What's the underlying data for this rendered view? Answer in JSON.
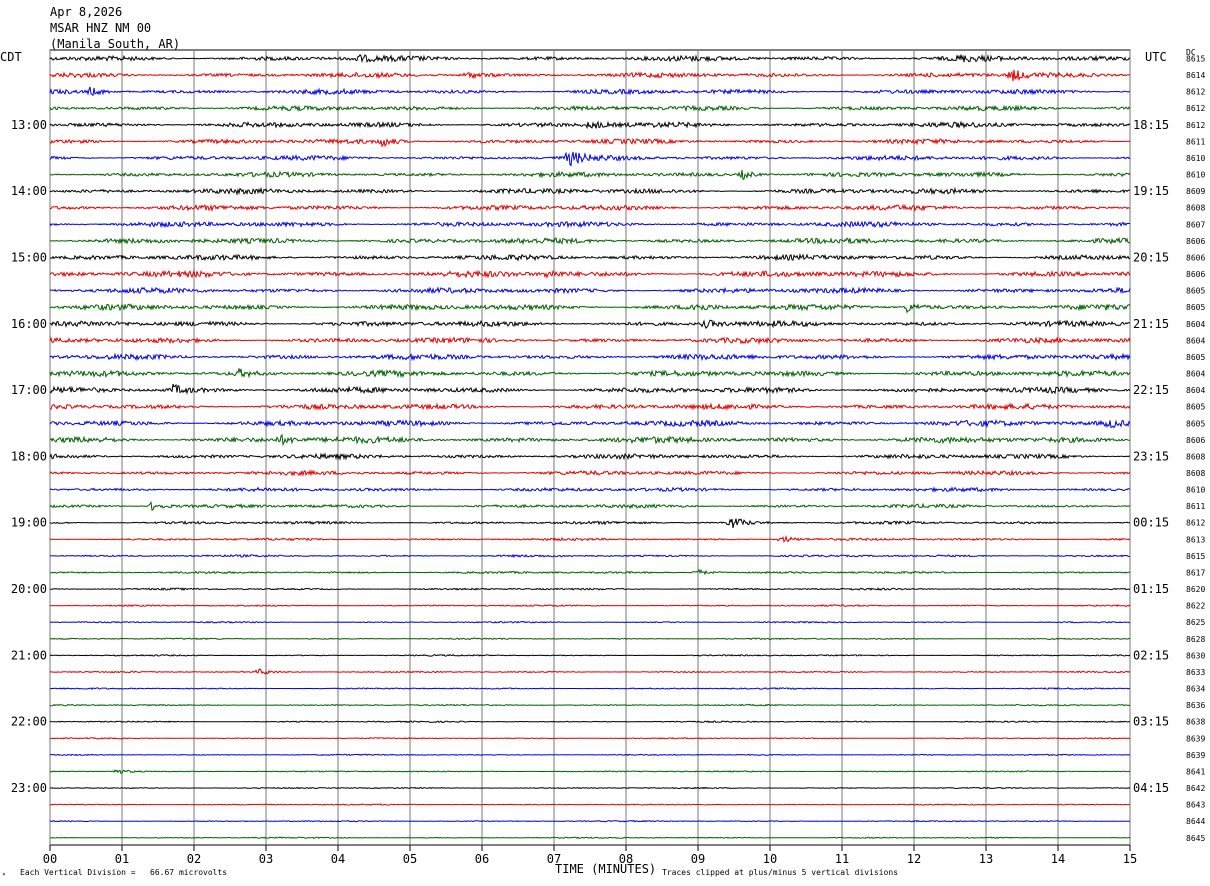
{
  "header": {
    "date": "Apr 8,2026",
    "station": "MSAR HNZ NM 00",
    "location": "(Manila South, AR)"
  },
  "labels": {
    "left_tz": "CDT",
    "right_tz": "UTC",
    "dc": "DC",
    "corner_mark": "ᴿ"
  },
  "footer": {
    "division_note": "Each Vertical Division =   66.67 microvolts",
    "clip_note": "Traces clipped at plus/minus 5 vertical divisions"
  },
  "chart_data": {
    "type": "line",
    "title": "",
    "xlabel": "TIME (MINUTES)",
    "ylabel": "",
    "xlim": [
      0,
      15
    ],
    "x_ticks": [
      "00",
      "01",
      "02",
      "03",
      "04",
      "05",
      "06",
      "07",
      "08",
      "09",
      "10",
      "11",
      "12",
      "13",
      "14",
      "15"
    ],
    "left_time_labels": [
      "13:00",
      "14:00",
      "15:00",
      "16:00",
      "17:00",
      "18:00",
      "19:00",
      "20:00",
      "21:00",
      "22:00",
      "23:00"
    ],
    "right_time_labels": [
      "18:15",
      "19:15",
      "20:15",
      "21:15",
      "22:15",
      "23:15",
      "00:15",
      "01:15",
      "02:15",
      "03:15",
      "04:15"
    ],
    "first_label_trace_index": 4,
    "traces_per_hour": 4,
    "trace_colors": [
      "#000000",
      "#e00000",
      "#0000e0",
      "#006000"
    ],
    "dc_offsets": [
      8615,
      8614,
      8612,
      8612,
      8612,
      8611,
      8610,
      8610,
      8609,
      8608,
      8607,
      8606,
      8606,
      8606,
      8605,
      8605,
      8604,
      8604,
      8605,
      8604,
      8604,
      8605,
      8605,
      8606,
      8608,
      8608,
      8610,
      8611,
      8612,
      8613,
      8615,
      8617,
      8620,
      8622,
      8625,
      8628,
      8630,
      8633,
      8634,
      8636,
      8638,
      8639,
      8639,
      8641,
      8642,
      8643,
      8644,
      8645
    ],
    "noise_level": [
      2.2,
      2.0,
      2.0,
      2.0,
      2.2,
      2.0,
      2.0,
      2.0,
      2.2,
      2.2,
      2.2,
      2.3,
      2.2,
      2.6,
      2.3,
      2.4,
      2.3,
      2.2,
      2.3,
      2.4,
      2.4,
      2.3,
      2.4,
      2.6,
      2.0,
      1.8,
      1.6,
      1.5,
      1.2,
      1.0,
      0.9,
      0.9,
      0.8,
      0.7,
      0.6,
      0.6,
      0.6,
      0.6,
      0.6,
      0.6,
      0.6,
      0.5,
      0.5,
      0.5,
      0.5,
      0.5,
      0.5,
      0.5
    ],
    "events": [
      {
        "trace": 0,
        "minute": 4.25,
        "amp": 3
      },
      {
        "trace": 0,
        "minute": 12.6,
        "amp": 3
      },
      {
        "trace": 1,
        "minute": 5.8,
        "amp": 3
      },
      {
        "trace": 1,
        "minute": 13.35,
        "amp": 6
      },
      {
        "trace": 2,
        "minute": 0.55,
        "amp": 4
      },
      {
        "trace": 4,
        "minute": 7.5,
        "amp": 4
      },
      {
        "trace": 5,
        "minute": 4.6,
        "amp": 5
      },
      {
        "trace": 6,
        "minute": 7.2,
        "amp": 7
      },
      {
        "trace": 7,
        "minute": 9.6,
        "amp": 5
      },
      {
        "trace": 13,
        "minute": 6.9,
        "amp": 4
      },
      {
        "trace": 15,
        "minute": 8.9,
        "amp": 4
      },
      {
        "trace": 15,
        "minute": 11.9,
        "amp": 5
      },
      {
        "trace": 16,
        "minute": 9.1,
        "amp": 4
      },
      {
        "trace": 19,
        "minute": 2.6,
        "amp": 4
      },
      {
        "trace": 20,
        "minute": 1.7,
        "amp": 5
      },
      {
        "trace": 22,
        "minute": 14.7,
        "amp": 4
      },
      {
        "trace": 23,
        "minute": 3.2,
        "amp": 4
      },
      {
        "trace": 27,
        "minute": 1.4,
        "amp": 5
      },
      {
        "trace": 28,
        "minute": 9.45,
        "amp": 7
      },
      {
        "trace": 29,
        "minute": 10.15,
        "amp": 4
      },
      {
        "trace": 31,
        "minute": 8.95,
        "amp": 4
      },
      {
        "trace": 37,
        "minute": 2.9,
        "amp": 3
      },
      {
        "trace": 43,
        "minute": 0.9,
        "amp": 3
      }
    ]
  }
}
